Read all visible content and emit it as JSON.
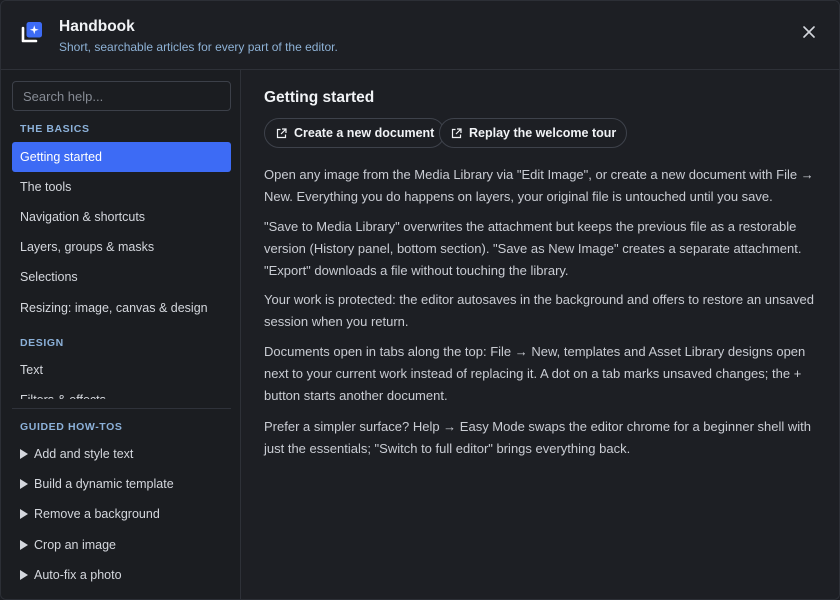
{
  "header": {
    "title": "Handbook",
    "subtitle": "Short, searchable articles for every part of the editor.",
    "logo_icon": "sparkle-frame-icon",
    "close_icon": "close-icon"
  },
  "colors": {
    "accent": "#3d6bf5",
    "section_label": "#8cb1d9",
    "background": "#1d1f24"
  },
  "sidebar": {
    "search_placeholder": "Search help...",
    "sections": [
      {
        "label": "THE BASICS",
        "items": [
          {
            "label": "Getting started",
            "active": true
          },
          {
            "label": "The tools"
          },
          {
            "label": "Navigation & shortcuts"
          },
          {
            "label": "Layers, groups & masks"
          },
          {
            "label": "Selections"
          },
          {
            "label": "Resizing: image, canvas & design"
          }
        ]
      },
      {
        "label": "DESIGN",
        "items": [
          {
            "label": "Text"
          },
          {
            "label": "Filters & effects"
          }
        ]
      }
    ],
    "howtos": {
      "label": "GUIDED HOW-TOS",
      "items": [
        {
          "label": "Add and style text"
        },
        {
          "label": "Build a dynamic template"
        },
        {
          "label": "Remove a background"
        },
        {
          "label": "Crop an image"
        },
        {
          "label": "Auto-fix a photo"
        }
      ]
    }
  },
  "article": {
    "title": "Getting started",
    "actions": [
      {
        "label": "Create a new document",
        "icon": "external-link-icon"
      },
      {
        "label": "Replay the welcome tour",
        "icon": "external-link-icon"
      }
    ],
    "paragraphs": [
      "Open any image from the Media Library via \"Edit Image\", or create a new document with File → New. Everything you do happens on layers, your original file is untouched until you save.",
      "\"Save to Media Library\" overwrites the attachment but keeps the previous file as a restorable version (History panel, bottom section). \"Save as New Image\" creates a separate attachment. \"Export\" downloads a file without touching the library.",
      "Your work is protected: the editor autosaves in the background and offers to restore an unsaved session when you return.",
      "Documents open in tabs along the top: File → New, templates and Asset Library designs open next to your current work instead of replacing it. A dot on a tab marks unsaved changes; the + button starts another document.",
      "Prefer a simpler surface? Help → Easy Mode swaps the editor chrome for a beginner shell with just the essentials; \"Switch to full editor\" brings everything back."
    ]
  }
}
